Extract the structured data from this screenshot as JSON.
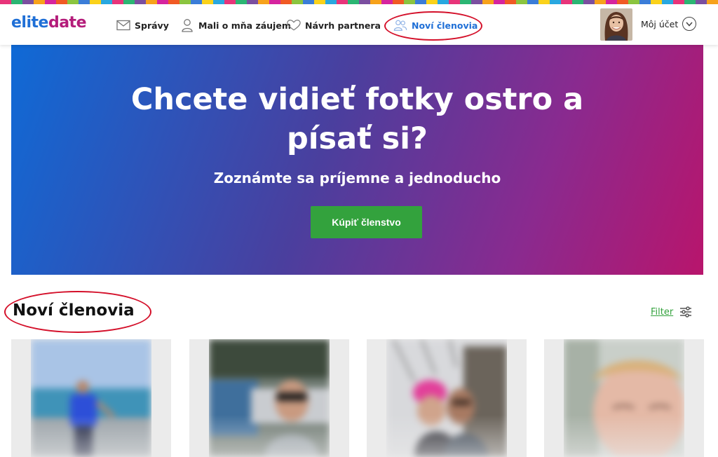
{
  "header": {
    "logo": {
      "part1": "elite",
      "part2": "date"
    },
    "nav": [
      {
        "label": "Správy",
        "icon": "envelope-icon"
      },
      {
        "label": "Mali o mňa záujem",
        "icon": "person-icon"
      },
      {
        "label": "Návrh partnera",
        "icon": "heart-icon"
      },
      {
        "label": "Noví členovia",
        "icon": "people-icon",
        "active": true
      }
    ],
    "account_label": "Môj účet",
    "account_icon": "chevron-down-icon"
  },
  "hero": {
    "title": "Chcete vidieť fotky ostro a písať si?",
    "subtitle": "Zoznámte sa príjemne a jednoducho",
    "button_label": "Kúpiť členstvo"
  },
  "section": {
    "title": "Noví členovia",
    "filter_label": "Filter",
    "filter_icon": "sliders-icon"
  },
  "members": [
    {
      "photo": "blurred-photo"
    },
    {
      "photo": "blurred-photo"
    },
    {
      "photo": "blurred-photo"
    },
    {
      "photo": "blurred-photo"
    }
  ],
  "colors": {
    "brand_blue": "#1f6fd6",
    "brand_magenta": "#b41c7a",
    "cta_green": "#33a23d",
    "annotation_red": "#d4102a"
  }
}
